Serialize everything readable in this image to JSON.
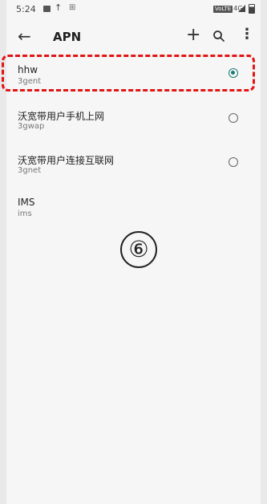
{
  "status_bar": {
    "time": "5:24",
    "icons": [
      "image-icon",
      "upload-icon",
      "misc-icon"
    ],
    "network": "4G",
    "volte": "VoLTE"
  },
  "toolbar": {
    "title": "APN",
    "back_icon": "arrow-left-icon",
    "add_icon": "plus-icon",
    "search_icon": "search-icon",
    "more_icon": "more-vert-icon"
  },
  "apn_list": [
    {
      "name": "hhw",
      "apn": "3gent",
      "selected": true
    },
    {
      "name": "沃宽带用户手机上网",
      "apn": "3gwap",
      "selected": false
    },
    {
      "name": "沃宽带用户连接互联网",
      "apn": "3gnet",
      "selected": false
    },
    {
      "name": "IMS",
      "apn": "ims",
      "selected": null
    }
  ],
  "annotation": {
    "marker": "⑥",
    "highlight_color": "#e21414"
  },
  "colors": {
    "accent": "#1e7d72",
    "background": "#f6f6f6"
  }
}
